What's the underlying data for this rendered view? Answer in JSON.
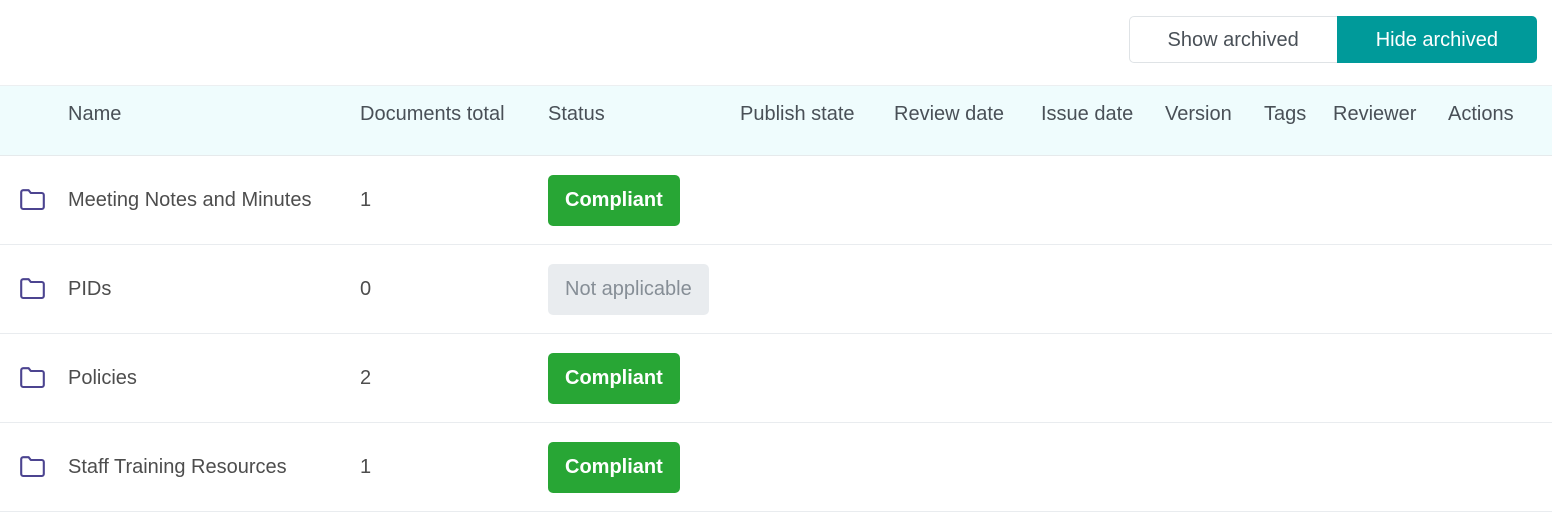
{
  "toolbar": {
    "show_archived_label": "Show archived",
    "hide_archived_label": "Hide archived",
    "active": "hide_archived",
    "accent_color": "#009a9a"
  },
  "table": {
    "columns": [
      {
        "key": "name",
        "label": "Name"
      },
      {
        "key": "documents_total",
        "label": "Documents total"
      },
      {
        "key": "status",
        "label": "Status"
      },
      {
        "key": "publish_state",
        "label": "Publish state"
      },
      {
        "key": "review_date",
        "label": "Review date"
      },
      {
        "key": "issue_date",
        "label": "Issue date"
      },
      {
        "key": "version",
        "label": "Version"
      },
      {
        "key": "tags",
        "label": "Tags"
      },
      {
        "key": "reviewer",
        "label": "Reviewer"
      },
      {
        "key": "actions",
        "label": "Actions"
      }
    ],
    "rows": [
      {
        "icon": "folder-icon",
        "name": "Meeting Notes and Minutes",
        "documents_total": "1",
        "status": "Compliant",
        "status_kind": "compliant",
        "publish_state": "",
        "review_date": "",
        "issue_date": "",
        "version": "",
        "tags": "",
        "reviewer": "",
        "actions": ""
      },
      {
        "icon": "folder-icon",
        "name": "PIDs",
        "documents_total": "0",
        "status": "Not applicable",
        "status_kind": "na",
        "publish_state": "",
        "review_date": "",
        "issue_date": "",
        "version": "",
        "tags": "",
        "reviewer": "",
        "actions": ""
      },
      {
        "icon": "folder-icon",
        "name": "Policies",
        "documents_total": "2",
        "status": "Compliant",
        "status_kind": "compliant",
        "publish_state": "",
        "review_date": "",
        "issue_date": "",
        "version": "",
        "tags": "",
        "reviewer": "",
        "actions": ""
      },
      {
        "icon": "folder-icon",
        "name": "Staff Training Resources",
        "documents_total": "1",
        "status": "Compliant",
        "status_kind": "compliant",
        "publish_state": "",
        "review_date": "",
        "issue_date": "",
        "version": "",
        "tags": "",
        "reviewer": "",
        "actions": ""
      }
    ]
  },
  "colors": {
    "header_background": "#effcfd",
    "compliant_badge": "#28a635",
    "na_badge_background": "#e9ecef",
    "na_badge_text": "#868e96",
    "folder_icon_stroke": "#4c4490"
  }
}
